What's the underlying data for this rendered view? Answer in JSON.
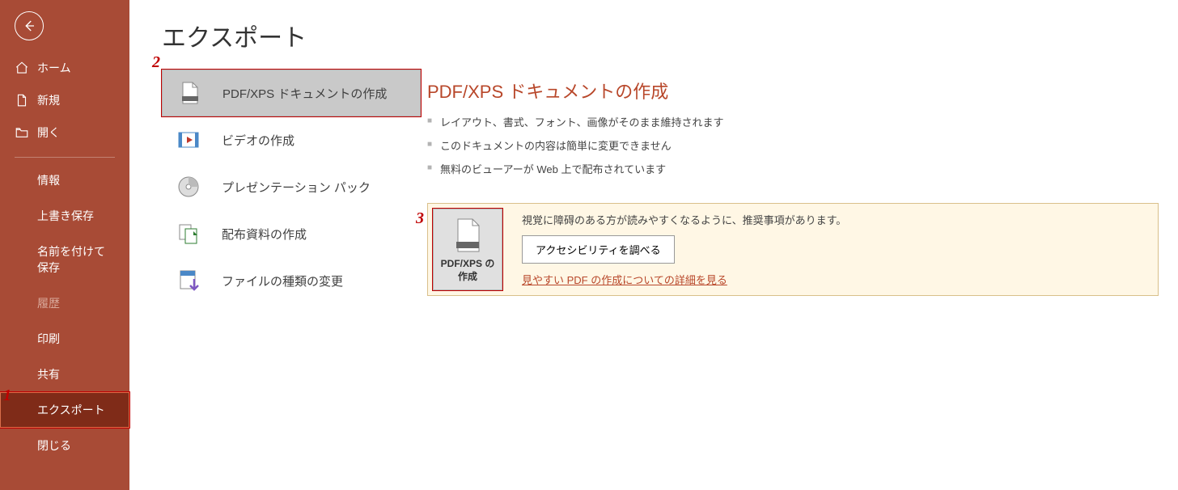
{
  "sidebar": {
    "top": [
      {
        "label": "ホーム",
        "icon": "home"
      },
      {
        "label": "新規",
        "icon": "file"
      },
      {
        "label": "開く",
        "icon": "folder"
      }
    ],
    "sub": [
      {
        "label": "情報"
      },
      {
        "label": "上書き保存"
      },
      {
        "label": "名前を付けて保存"
      },
      {
        "label": "履歴",
        "disabled": true
      },
      {
        "label": "印刷"
      },
      {
        "label": "共有"
      },
      {
        "label": "エクスポート",
        "selected": true
      },
      {
        "label": "閉じる"
      }
    ]
  },
  "page": {
    "title": "エクスポート"
  },
  "export_options": [
    {
      "label": "PDF/XPS ドキュメントの作成",
      "icon": "pdf",
      "selected": true
    },
    {
      "label": "ビデオの作成",
      "icon": "video"
    },
    {
      "label": "プレゼンテーション パック",
      "icon": "disc"
    },
    {
      "label": "配布資料の作成",
      "icon": "handout"
    },
    {
      "label": "ファイルの種類の変更",
      "icon": "filesave"
    }
  ],
  "detail": {
    "title": "PDF/XPS ドキュメントの作成",
    "bullets": [
      "レイアウト、書式、フォント、画像がそのまま維持されます",
      "このドキュメントの内容は簡単に変更できません",
      "無料のビューアーが Web 上で配布されています"
    ],
    "action_button_label": "PDF/XPS の作成",
    "accessibility_desc": "視覚に障碍のある方が読みやすくなるように、推奨事項があります。",
    "accessibility_button": "アクセシビリティを調べる",
    "link_text": "見やすい PDF の作成についての詳細を見る"
  },
  "callouts": {
    "c1": "1",
    "c2": "2",
    "c3": "3"
  }
}
